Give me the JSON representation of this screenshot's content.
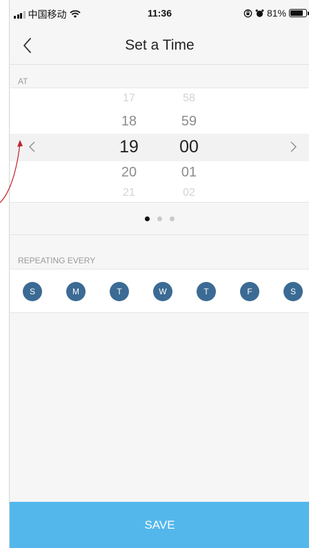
{
  "status_bar": {
    "carrier": "中国移动",
    "time": "11:36",
    "battery": "81%",
    "battery_level": 0.81
  },
  "nav": {
    "title": "Set a Time"
  },
  "picker": {
    "section_label": "AT",
    "hours": [
      "17",
      "18",
      "19",
      "20",
      "21"
    ],
    "minutes": [
      "58",
      "59",
      "00",
      "01",
      "02"
    ],
    "selected_hour": "19",
    "selected_minute": "00"
  },
  "pager": {
    "total": 3,
    "active": 1
  },
  "repeat": {
    "section_label": "REPEATING EVERY",
    "days": [
      "S",
      "M",
      "T",
      "W",
      "T",
      "F",
      "S"
    ]
  },
  "save_label": "SAVE",
  "colors": {
    "day_circle": "#3b6b94",
    "save_button": "#53b7ec",
    "annotation_arrow": "#c0232c"
  }
}
